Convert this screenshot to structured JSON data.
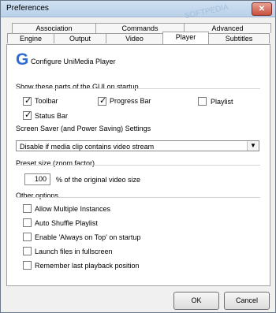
{
  "window": {
    "title": "Preferences",
    "close_glyph": "✕",
    "watermark": "SOFTPEDIA"
  },
  "tabs": {
    "row1": [
      "Association",
      "Commands",
      "Advanced"
    ],
    "row2": [
      "Engine",
      "Output",
      "Video",
      "Player",
      "Subtitles"
    ],
    "active": "Player"
  },
  "header": {
    "logo_glyph": "G",
    "title": "Configure UniMedia Player"
  },
  "gui_section": {
    "label": "Show these parts of the GUI on startup",
    "items": [
      {
        "label": "Toolbar",
        "checked": true
      },
      {
        "label": "Progress Bar",
        "checked": true
      },
      {
        "label": "Playlist",
        "checked": false
      },
      {
        "label": "Status Bar",
        "checked": true
      }
    ]
  },
  "screensaver": {
    "label": "Screen Saver (and Power Saving) Settings",
    "value": "Disable if media clip contains video stream"
  },
  "preset": {
    "label": "Preset size (zoom factor)",
    "value": "100",
    "suffix": "% of the original video size"
  },
  "other": {
    "label": "Other options",
    "items": [
      {
        "label": "Allow Multiple Instances",
        "checked": false
      },
      {
        "label": "Auto Shuffle Playlist",
        "checked": false
      },
      {
        "label": "Enable 'Always on Top' on startup",
        "checked": false
      },
      {
        "label": "Launch files in fullscreen",
        "checked": false
      },
      {
        "label": "Remember last playback position",
        "checked": false
      }
    ]
  },
  "buttons": {
    "ok": "OK",
    "cancel": "Cancel"
  }
}
